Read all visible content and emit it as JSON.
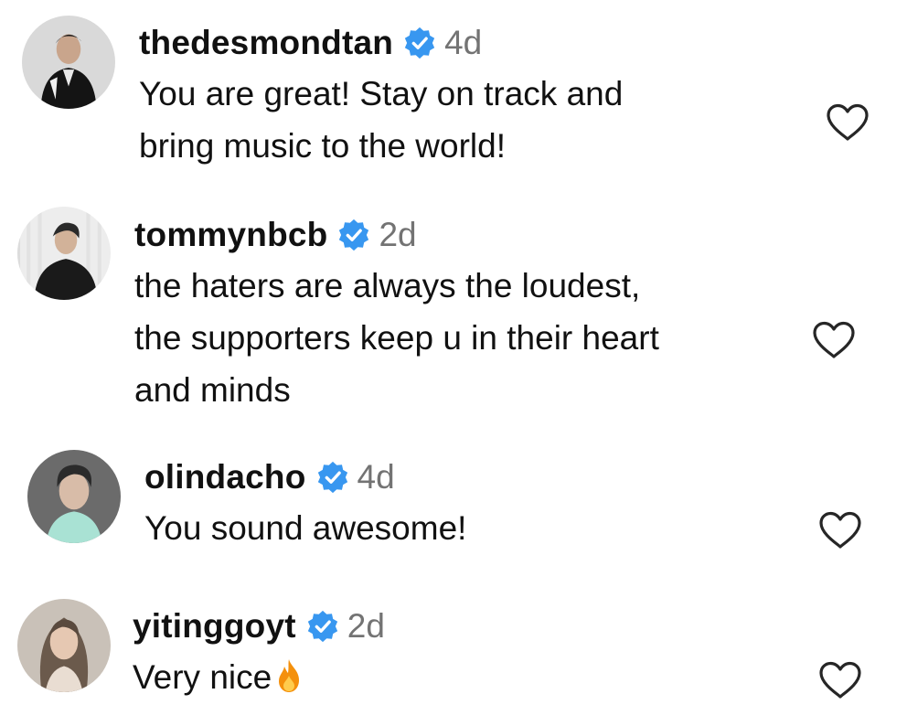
{
  "comments": [
    {
      "username": "thedesmondtan",
      "verified_icon": "verified-badge-icon",
      "time": "4d",
      "lines": [
        "You are great! Stay on track and",
        "bring music to the world!"
      ],
      "like_icon": "heart-outline-icon"
    },
    {
      "username": "tommynbcb",
      "verified_icon": "verified-badge-icon",
      "time": "2d",
      "lines": [
        "the haters are always the loudest,",
        "the supporters keep u in their heart",
        "and minds"
      ],
      "like_icon": "heart-outline-icon"
    },
    {
      "username": "olindacho",
      "verified_icon": "verified-badge-icon",
      "time": "4d",
      "lines": [
        "You sound awesome!"
      ],
      "like_icon": "heart-outline-icon"
    },
    {
      "username": "yitinggoyt",
      "verified_icon": "verified-badge-icon",
      "time": "2d",
      "lines": [
        "Very nice"
      ],
      "emoji_icon": "fire-emoji-icon",
      "like_icon": "heart-outline-icon"
    }
  ],
  "colors": {
    "verified_blue": "#3897f0",
    "time_gray": "#737373",
    "text": "#111111"
  }
}
